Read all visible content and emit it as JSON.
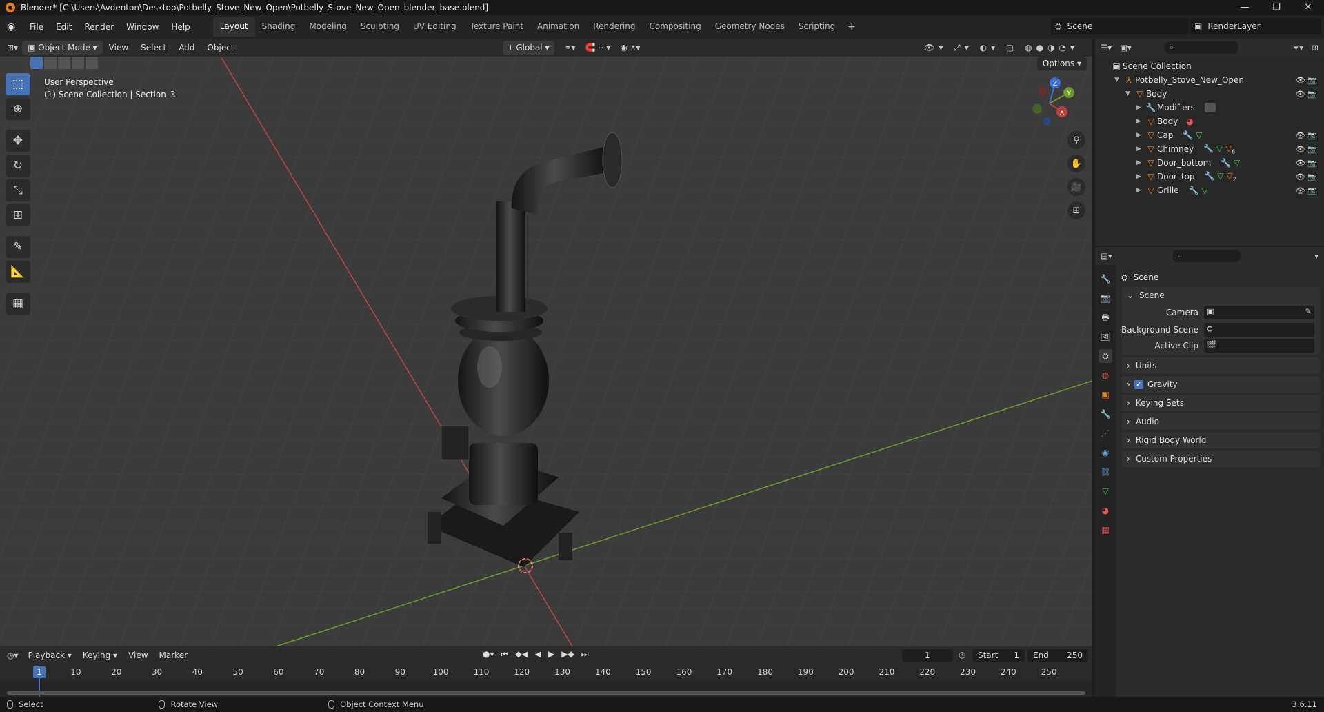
{
  "window": {
    "title": "Blender* [C:\\Users\\Avdenton\\Desktop\\Potbelly_Stove_New_Open\\Potbelly_Stove_New_Open_blender_base.blend]",
    "min": "—",
    "max": "❐",
    "close": "✕"
  },
  "menu": [
    "File",
    "Edit",
    "Render",
    "Window",
    "Help"
  ],
  "workspaces": [
    "Layout",
    "Shading",
    "Modeling",
    "Sculpting",
    "UV Editing",
    "Texture Paint",
    "Animation",
    "Rendering",
    "Compositing",
    "Geometry Nodes",
    "Scripting"
  ],
  "workspace_add": "+",
  "scene": "Scene",
  "render_layer": "RenderLayer",
  "viewport_header": {
    "mode": "Object Mode",
    "menus": [
      "View",
      "Select",
      "Add",
      "Object"
    ],
    "orientation": "Global",
    "options": "Options"
  },
  "viewport": {
    "perspective": "User Perspective",
    "collection": "(1) Scene Collection | Section_3"
  },
  "gizmo": {
    "z": "Z",
    "y": "Y",
    "x": "X"
  },
  "outliner": {
    "search_placeholder": "⌕",
    "root": "Scene Collection",
    "collection": "Potbelly_Stove_New_Open",
    "object": "Body",
    "children": [
      "Modifiers",
      "Body",
      "Cap",
      "Chimney",
      "Door_bottom",
      "Door_top",
      "Grille"
    ],
    "badge_chimney": "6",
    "badge_door_top": "2"
  },
  "properties": {
    "search_placeholder": "⌕",
    "title": "Scene",
    "panel_scene": "Scene",
    "camera_label": "Camera",
    "bg_scene_label": "Background Scene",
    "active_clip_label": "Active Clip",
    "panels": [
      "Units",
      "Gravity",
      "Keying Sets",
      "Audio",
      "Rigid Body World",
      "Custom Properties"
    ]
  },
  "timeline": {
    "menus": [
      "Playback",
      "Keying",
      "View",
      "Marker"
    ],
    "current_frame": "1",
    "start_label": "Start",
    "start": "1",
    "end_label": "End",
    "end": "250",
    "ticks": [
      "1",
      "10",
      "20",
      "30",
      "40",
      "50",
      "60",
      "70",
      "80",
      "90",
      "100",
      "110",
      "120",
      "130",
      "140",
      "150",
      "160",
      "170",
      "180",
      "190",
      "200",
      "210",
      "220",
      "230",
      "240",
      "250"
    ]
  },
  "status": {
    "select": "Select",
    "rotate": "Rotate View",
    "context": "Object Context Menu",
    "version": "3.6.11"
  },
  "colors": {
    "accent": "#4772b3",
    "orange": "#e87d0d",
    "x_axis": "#c23b3b",
    "y_axis": "#6e9a2a"
  }
}
